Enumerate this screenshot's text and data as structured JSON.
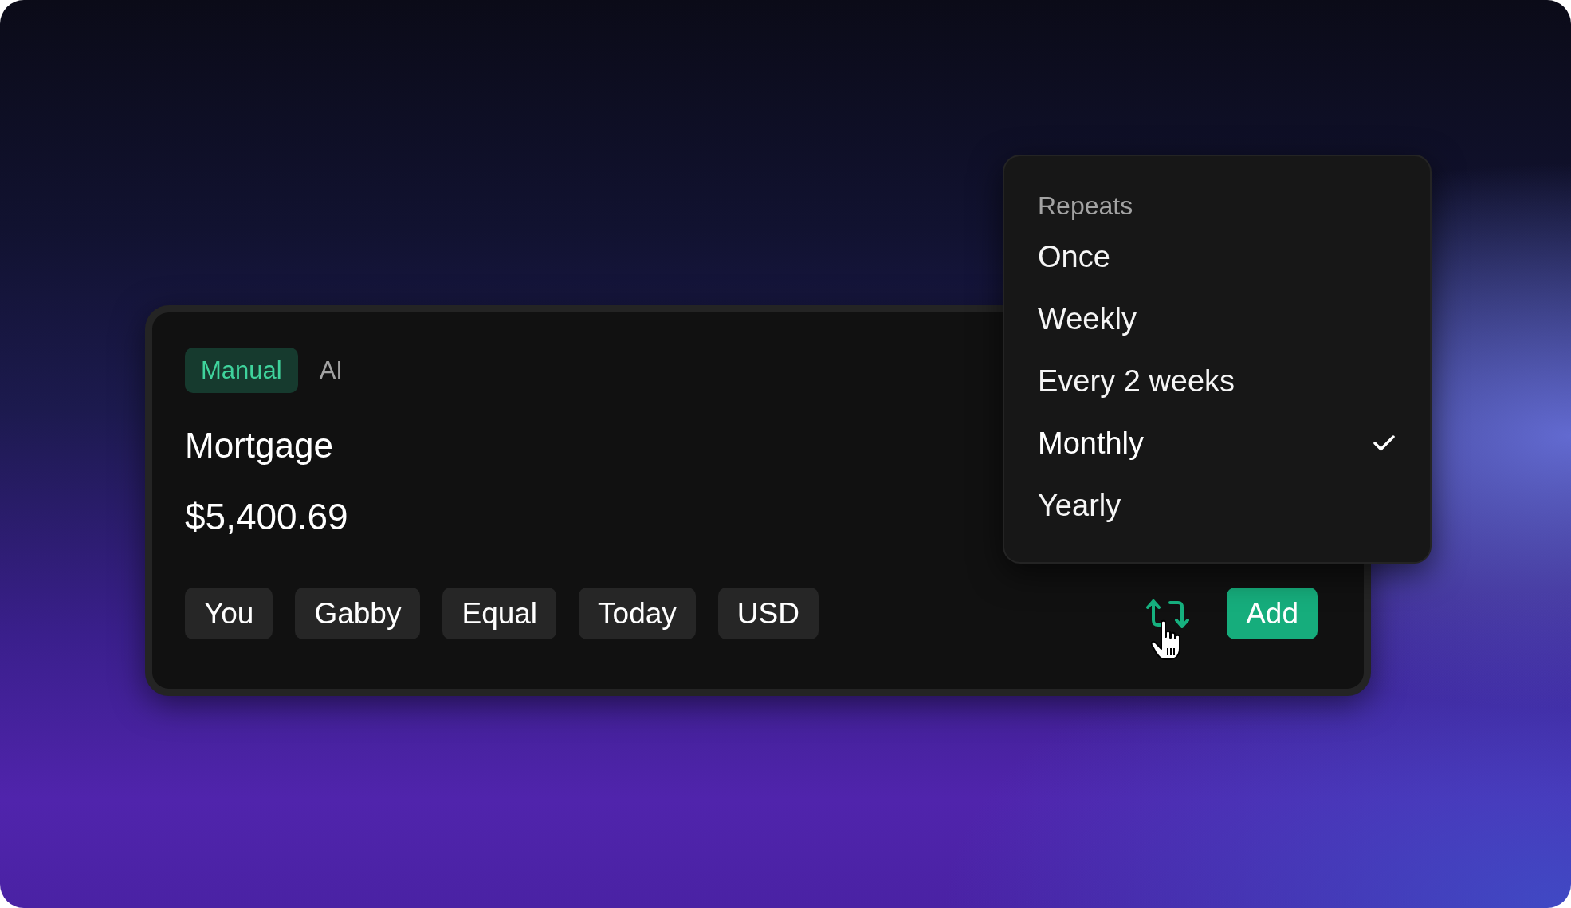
{
  "mode_tabs": [
    {
      "label": "Manual",
      "selected": true
    },
    {
      "label": "AI",
      "selected": false
    }
  ],
  "expense": {
    "title": "Mortgage",
    "amount": "$5,400.69"
  },
  "chips": [
    "You",
    "Gabby",
    "Equal",
    "Today",
    "USD"
  ],
  "add_button": {
    "label": "Add"
  },
  "repeat_menu": {
    "heading": "Repeats",
    "options": [
      {
        "label": "Once",
        "selected": false
      },
      {
        "label": "Weekly",
        "selected": false
      },
      {
        "label": "Every 2 weeks",
        "selected": false
      },
      {
        "label": "Monthly",
        "selected": true
      },
      {
        "label": "Yearly",
        "selected": false
      }
    ]
  }
}
